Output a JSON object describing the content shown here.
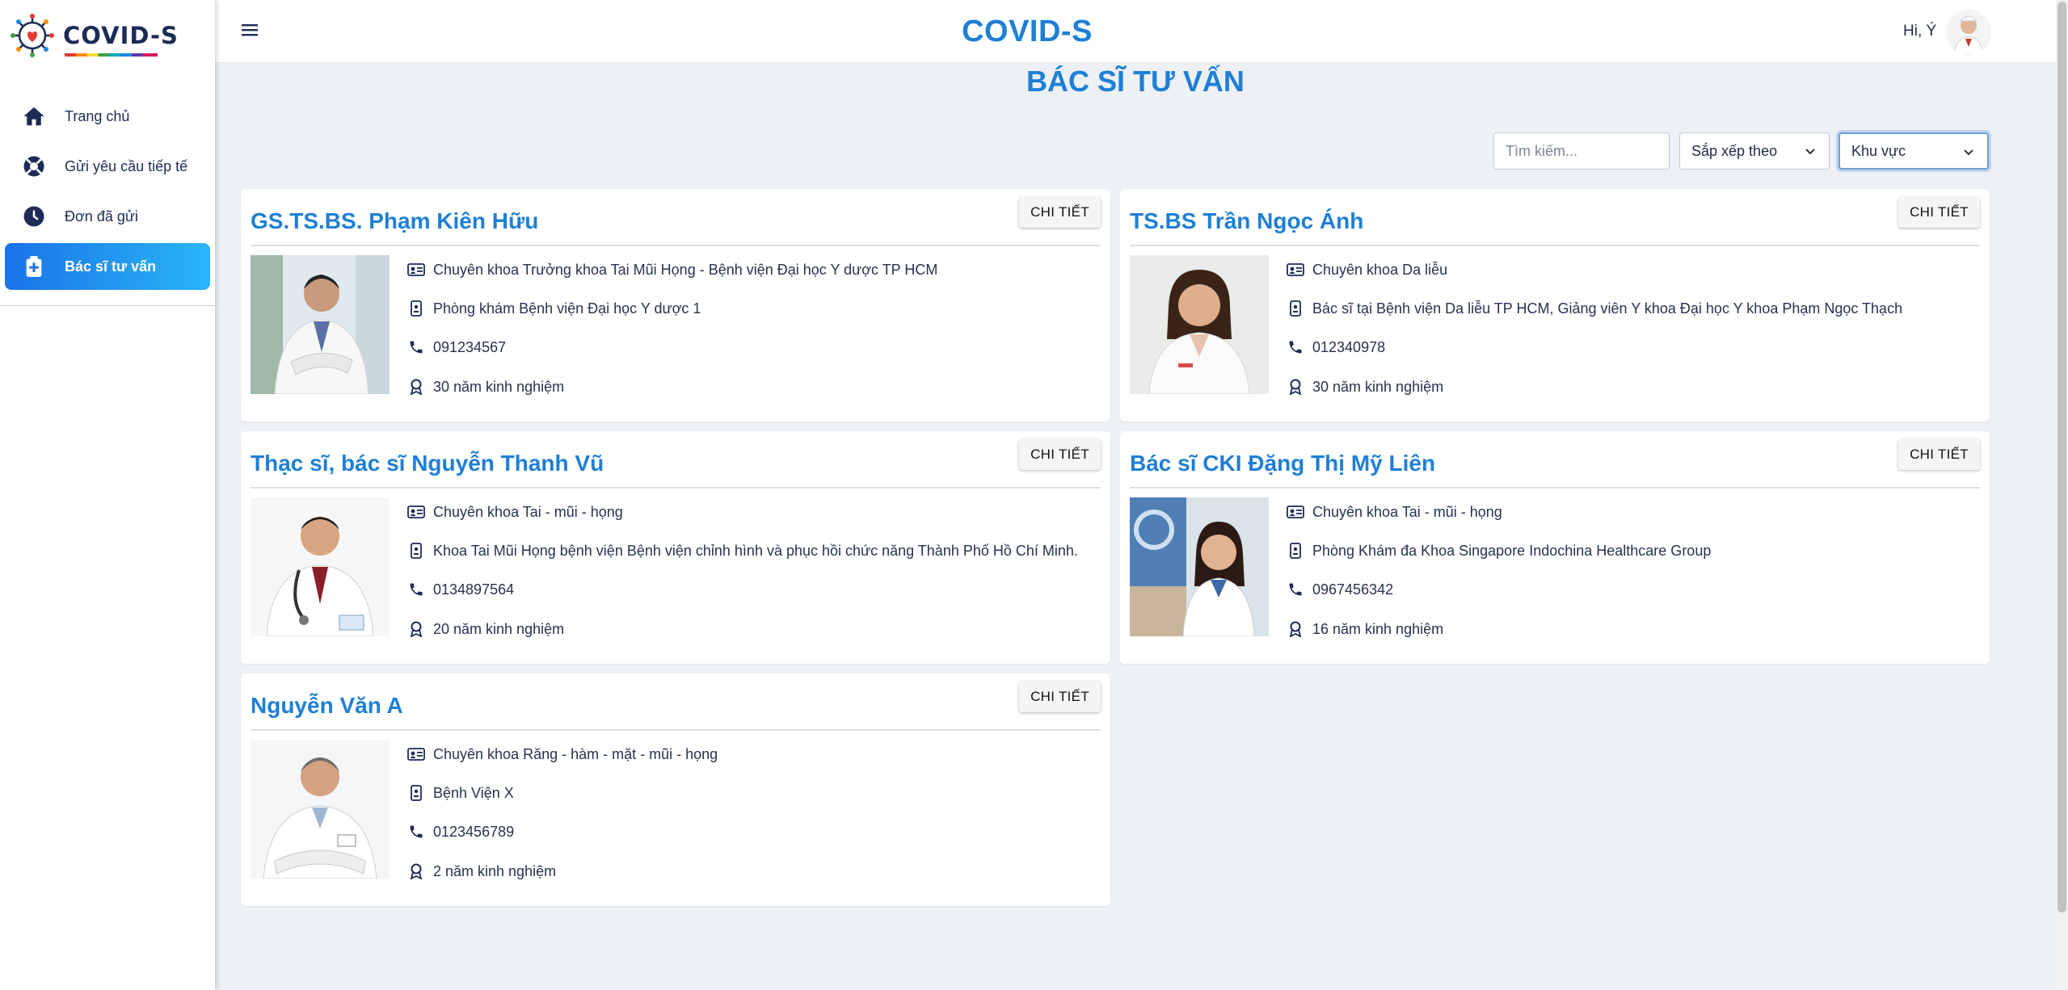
{
  "app": {
    "title": "COVID-S",
    "logo_text": "COVID-S"
  },
  "header": {
    "greeting": "Hi, Ý"
  },
  "sidebar": {
    "items": [
      {
        "label": "Trang chủ",
        "icon": "home-icon",
        "active": false
      },
      {
        "label": "Gửi yêu cầu tiếp tế",
        "icon": "lifebuoy-icon",
        "active": false
      },
      {
        "label": "Đơn đã gửi",
        "icon": "clock-icon",
        "active": false
      },
      {
        "label": "Bác sĩ tư vấn",
        "icon": "medical-kit-icon",
        "active": true
      }
    ]
  },
  "page": {
    "heading": "BÁC SĨ TƯ VẤN"
  },
  "filters": {
    "search_placeholder": "Tìm kiếm...",
    "sort_label": "Sắp xếp theo",
    "region_label": "Khu vực"
  },
  "doctors": [
    {
      "name": "GS.TS.BS. Phạm Kiên Hữu",
      "detail_label": "CHI TIẾT",
      "specialty": "Chuyên khoa Trưởng khoa Tai Mũi Họng - Bệnh viện Đại học Y dược TP HCM",
      "workplace": "Phòng khám Bệnh viện Đại học Y dược 1",
      "phone": "091234567",
      "experience": "30 năm kinh nghiệm"
    },
    {
      "name": "TS.BS Trần Ngọc Ánh",
      "detail_label": "CHI TIẾT",
      "specialty": "Chuyên khoa Da liễu",
      "workplace": "Bác sĩ tại Bệnh viện Da liễu TP HCM, Giảng viên Y khoa Đại học Y khoa Phạm Ngọc Thạch",
      "phone": "012340978",
      "experience": "30 năm kinh nghiệm"
    },
    {
      "name": "Thạc sĩ, bác sĩ Nguyễn Thanh Vũ",
      "detail_label": "CHI TIẾT",
      "specialty": "Chuyên khoa Tai - mũi - họng",
      "workplace": "Khoa Tai Mũi Họng bệnh viện Bệnh viện chỉnh hình và phục hồi chức năng Thành Phố Hồ Chí Minh.",
      "phone": "0134897564",
      "experience": "20 năm kinh nghiệm"
    },
    {
      "name": "Bác sĩ CKI Đặng Thị Mỹ Liên",
      "detail_label": "CHI TIẾT",
      "specialty": "Chuyên khoa Tai - mũi - họng",
      "workplace": "Phòng Khám đa Khoa Singapore Indochina Healthcare Group",
      "phone": "0967456342",
      "experience": "16 năm kinh nghiệm"
    },
    {
      "name": "Nguyễn Văn A",
      "detail_label": "CHI TIẾT",
      "specialty": "Chuyên khoa Răng - hàm - mặt - mũi - họng",
      "workplace": "Bệnh Viện X",
      "phone": "0123456789",
      "experience": "2 năm kinh nghiệm"
    }
  ],
  "colors": {
    "accent": "#1e7fd6",
    "active_start": "#1a73e8",
    "active_end": "#29b6f6",
    "navy": "#1d2b55"
  }
}
